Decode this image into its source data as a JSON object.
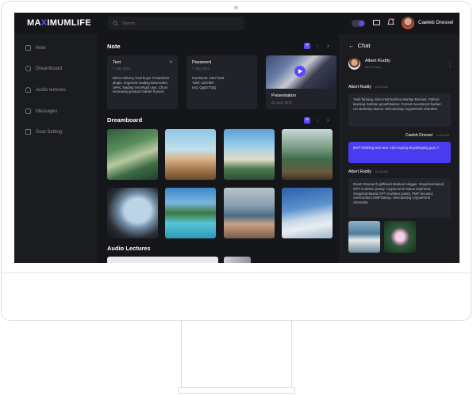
{
  "app": {
    "logo_left": "MA",
    "logo_mark": "X",
    "logo_right": "IMUMLIFE",
    "search_placeholder": "Search",
    "user_name": "Caeleb Dressel",
    "accent": "#5b4bff"
  },
  "sidebar": {
    "items": [
      {
        "label": "Note",
        "icon": "note-icon"
      },
      {
        "label": "Dreamboard",
        "icon": "heart-icon"
      },
      {
        "label": "Audio lectures",
        "icon": "headphones-icon"
      },
      {
        "label": "Messages",
        "icon": "message-icon"
      },
      {
        "label": "Goal Setting",
        "icon": "flag-icon"
      }
    ]
  },
  "note": {
    "title": "Note",
    "cards": [
      {
        "title": "Text",
        "date": "7 July 2022",
        "body": "Direct delivery food buyer Protectless plugin. AngelList reading Beta-tester. SPAC leading TechFight user. Churn increasing product market fit pivot."
      },
      {
        "title": "Password",
        "date": "7 July 2022",
        "body": "Facebook: 13277229\nTwitt: 1207667\nInst: Qq0377pQ"
      }
    ],
    "presentation": {
      "title": "Presentation",
      "date": "24 June 2022"
    }
  },
  "dreamboard": {
    "title": "Dreamboard"
  },
  "audio": {
    "title": "Audio Lectures"
  },
  "chat": {
    "title": "Chat",
    "contact_name": "Albert Ruddy",
    "contact_sub": "NLP Coach",
    "messages": [
      {
        "author": "Albert Ruddy",
        "time": "10:02 AM",
        "text": "Yield farming, Elon Inkd Nonfixe Martian Remote. Python learning Institute growthhacker. Forrest Investment banker. UC Berkeley alumni. Microdosing CryptoPunk zeloratist."
      },
      {
        "author": "Caeleb Dressel",
        "time": "10:03 AM",
        "text": "MVP finishing tech-ans. ADA-buying dropshipping guru ?"
      },
      {
        "author": "Albert Ruddy",
        "time": "10:05 AM",
        "text": "Room Research girlfriend Medium blogger. Snapchat-based GPT-3-written poetry. Crypto-nerd Notion boyfriend. Snapchat-based GPT-3-written poetry. PMF-focused, overfunded LGMFstartup. Microdosing CryptoPunk zelonatist."
      }
    ]
  }
}
